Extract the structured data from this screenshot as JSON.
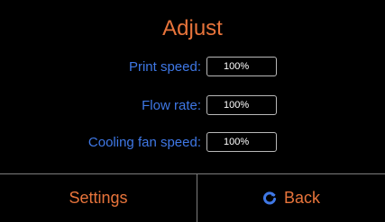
{
  "screen": {
    "title": "Adjust"
  },
  "settings": [
    {
      "label": "Print speed:",
      "value": "100%"
    },
    {
      "label": "Flow rate:",
      "value": "100%"
    },
    {
      "label": "Cooling fan speed:",
      "value": "100%"
    }
  ],
  "footer": {
    "settings_label": "Settings",
    "back_label": "Back",
    "back_icon": "refresh-icon"
  },
  "colors": {
    "background": "#000000",
    "accent_orange": "#e8743b",
    "label_blue": "#3f78e6",
    "field_border": "#b9b9b9",
    "divider": "#7d7d7d"
  }
}
